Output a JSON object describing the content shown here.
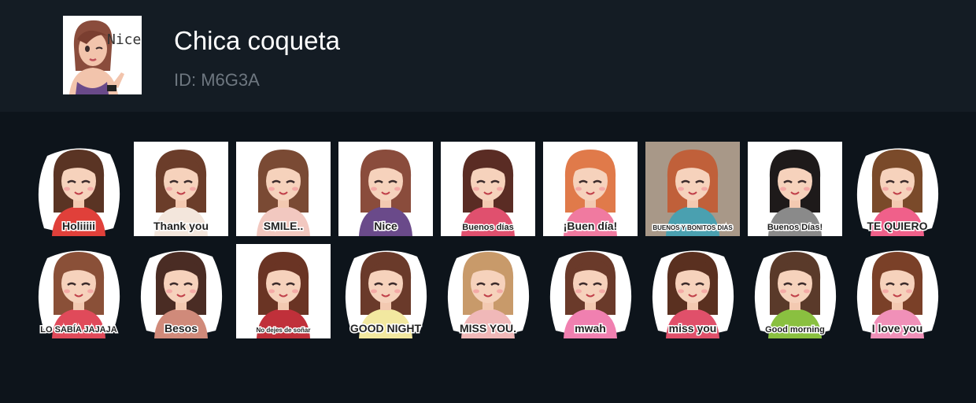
{
  "pack": {
    "title": "Chica coqueta",
    "id_label": "ID: M6G3A",
    "icon_caption": "Nice"
  },
  "stickers": [
    {
      "name": "sticker-holiiii",
      "caption": "Holiiiii",
      "bg": "none",
      "hair": "#5a3424",
      "shirt": "#e0403a"
    },
    {
      "name": "sticker-thank-you",
      "caption": "Thank you",
      "bg": "#ffffff",
      "hair": "#6b3d2a",
      "shirt": "#f3e6dc"
    },
    {
      "name": "sticker-smile",
      "caption": "SMILE..",
      "bg": "#ffffff",
      "hair": "#7a4a34",
      "shirt": "#f2c8c0"
    },
    {
      "name": "sticker-nice",
      "caption": "Nice",
      "bg": "#ffffff",
      "hair": "#8a4c3c",
      "shirt": "#6a4a8a"
    },
    {
      "name": "sticker-buenos-dias",
      "caption": "Buenos días",
      "bg": "#ffffff",
      "hair": "#5a2c24",
      "shirt": "#e0506e"
    },
    {
      "name": "sticker-hola-buen-dia",
      "caption": "¡Buen día!",
      "bg": "#ffffff",
      "hair": "#e07a4a",
      "shirt": "#f07aa0"
    },
    {
      "name": "sticker-buenos-y-bonitos-dias",
      "caption": "BUENOS Y BONITOS DIAS",
      "bg": "#a89888",
      "hair": "#c0603a",
      "shirt": "#4aa0b0"
    },
    {
      "name": "sticker-buenos-dias-scarf",
      "caption": "Buenos Días!",
      "bg": "#ffffff",
      "hair": "#1e1a1a",
      "shirt": "#8a8a8a"
    },
    {
      "name": "sticker-te-quiero",
      "caption": "TE QUIERO",
      "bg": "none",
      "hair": "#7a4a2a",
      "shirt": "#f0608a"
    },
    {
      "name": "sticker-lo-sabia-jajaja",
      "caption": "LO SABÍA JAJAJA",
      "bg": "none",
      "hair": "#8a5038",
      "shirt": "#e04a5a"
    },
    {
      "name": "sticker-besos",
      "caption": "Besos",
      "bg": "none",
      "hair": "#4a2c24",
      "shirt": "#d08a7a"
    },
    {
      "name": "sticker-no-dejes-de-sonar",
      "caption": "No dejes de soñar",
      "bg": "#ffffff",
      "hair": "#6a3424",
      "shirt": "#c0303a"
    },
    {
      "name": "sticker-good-night",
      "caption": "GOOD NIGHT",
      "bg": "none",
      "hair": "#6a3a2a",
      "shirt": "#f2e8a0"
    },
    {
      "name": "sticker-miss-you-blonde",
      "caption": "MISS YOU.",
      "bg": "none",
      "hair": "#c89a6a",
      "shirt": "#f0b8b8"
    },
    {
      "name": "sticker-mwah",
      "caption": "mwah",
      "bg": "none",
      "hair": "#6a3a2a",
      "shirt": "#f080b0"
    },
    {
      "name": "sticker-miss-you",
      "caption": "miss you",
      "bg": "none",
      "hair": "#5a3020",
      "shirt": "#e0506a"
    },
    {
      "name": "sticker-good-morning",
      "caption": "Good morning",
      "bg": "none",
      "hair": "#5a3a2a",
      "shirt": "#8ac040"
    },
    {
      "name": "sticker-i-love-you",
      "caption": "I love you",
      "bg": "none",
      "hair": "#7a4028",
      "shirt": "#f090b8"
    }
  ]
}
